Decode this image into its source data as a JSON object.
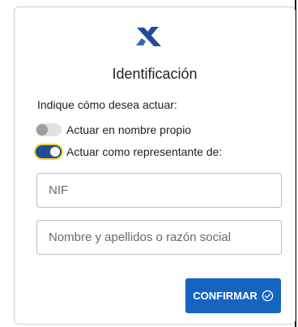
{
  "header": {
    "title": "Identificación"
  },
  "form": {
    "prompt": "Indique cómo desea actuar:",
    "options": [
      {
        "label": "Actuar en nombre propio",
        "selected": false
      },
      {
        "label": "Actuar como representante de:",
        "selected": true
      }
    ],
    "nif": {
      "value": "",
      "placeholder": "NIF"
    },
    "nombre": {
      "value": "",
      "placeholder": "Nombre y apellidos o razón social"
    },
    "confirm_label": "CONFIRMAR"
  },
  "icons": {
    "logo": "agency-logo-icon",
    "confirm": "check-circle-icon"
  },
  "colors": {
    "brand_blue": "#1f4e96",
    "button_blue": "#1565c0",
    "focus_yellow": "#ffd12a",
    "border": "#bdbdbd"
  }
}
